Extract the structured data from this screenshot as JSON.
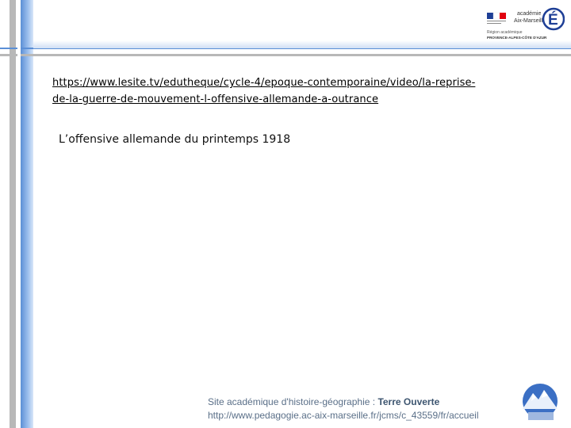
{
  "slide": {
    "link_line1": "https://www.lesite.tv/edutheque/cycle-4/epoque-contemporaine/video/la-reprise-",
    "link_line2": "de-la-guerre-de-mouvement-l-offensive-allemande-a-outrance",
    "subtitle": "L’offensive allemande du printemps 1918"
  },
  "header_logo": {
    "line1": "académie",
    "line2": "Aix-Marseille",
    "line3": "Région académique",
    "line4": "PROVENCE-ALPES-CÔTE D'AZUR",
    "letter": "É"
  },
  "footer": {
    "prefix": "Site académique d'histoire-géographie : ",
    "brand": "Terre Ouverte",
    "url": "http://www.pedagogie.ac-aix-marseille.fr/jcms/c_43559/fr/accueil"
  },
  "colors": {
    "accent_blue": "#5b8fd6",
    "bar_gray": "#a8a8a8",
    "footer_text": "#5a6f88"
  }
}
